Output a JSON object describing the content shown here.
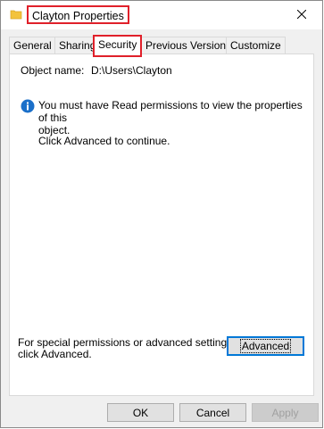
{
  "window": {
    "title": "Clayton Properties",
    "title_icon": "folder-icon",
    "close_icon": "close-icon"
  },
  "tabs": [
    {
      "label": "General",
      "active": false
    },
    {
      "label": "Sharing",
      "active": false
    },
    {
      "label": "Security",
      "active": true
    },
    {
      "label": "Previous Versions",
      "active": false
    },
    {
      "label": "Customize",
      "active": false
    }
  ],
  "security": {
    "object_name_label": "Object name:",
    "object_name_value": "D:\\Users\\Clayton",
    "info_icon": "info-icon",
    "message_line1": "You must have Read permissions to view the properties of this",
    "message_line2": "object.",
    "continue_text": "Click Advanced to continue.",
    "special_line1": "For special permissions or advanced settings,",
    "special_line2": "click Advanced.",
    "advanced_button": "Advanced"
  },
  "footer": {
    "ok": "OK",
    "cancel": "Cancel",
    "apply": "Apply"
  },
  "colors": {
    "highlight_red": "#e0202a",
    "focus_blue": "#0078d7",
    "info_blue": "#1a6fc9"
  }
}
